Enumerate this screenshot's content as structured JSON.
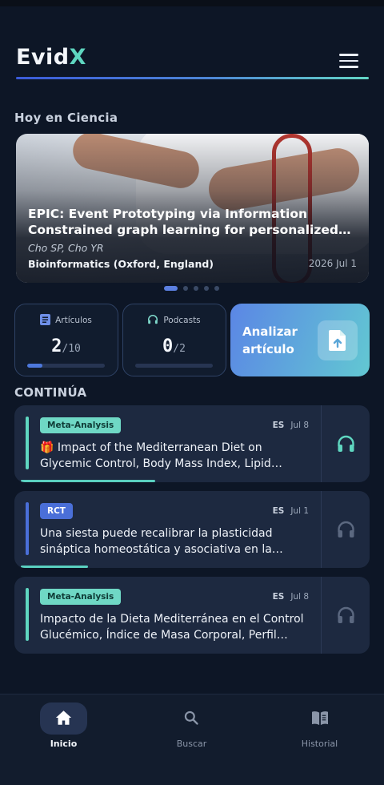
{
  "app": {
    "logo_main": "Evid",
    "logo_accent": "X",
    "menu_icon": "hamburger-menu-icon"
  },
  "today": {
    "section_title": "Hoy en Ciencia",
    "featured": {
      "title": "EPIC: Event Prototyping via Information Constrained graph learning for personalized care prediction",
      "authors": "Cho SP, Cho YR",
      "journal": "Bioinformatics (Oxford, England)",
      "date": "2026 Jul 1"
    },
    "carousel": {
      "count": 5,
      "active_index": 0
    }
  },
  "stats": {
    "articles": {
      "label": "Artículos",
      "icon": "document-icon",
      "value": "2",
      "total": "/10",
      "progress": 0.2
    },
    "podcasts": {
      "label": "Podcasts",
      "icon": "headphones-icon",
      "value": "0",
      "total": "/2",
      "progress": 0
    }
  },
  "analyze": {
    "label": "Analizar artículo",
    "icon": "file-upload-icon"
  },
  "continue": {
    "section_title": "CONTINÚA",
    "items": [
      {
        "badge": "Meta-Analysis",
        "badge_bg": "#6fd8c5",
        "badge_fg": "#0f3b36",
        "accent": "#5fd6c0",
        "lang": "ES",
        "date": "Jul 8",
        "emoji": "🎁",
        "title": "Impact of the Mediterranean Diet on Glycemic Control, Body Mass Index, Lipid Profile and Blood Pressure",
        "headphones_color": "#5fd6c0",
        "progress": 0.4
      },
      {
        "badge": "RCT",
        "badge_bg": "#4a6fd8",
        "badge_fg": "#ffffff",
        "accent": "#4a6fd8",
        "lang": "ES",
        "date": "Jul 1",
        "emoji": "",
        "title": "Una siesta puede recalibrar la plasticidad sináptica homeostática y asociativa en la corteza humana",
        "headphones_color": "#5b6880",
        "progress": 0.2
      },
      {
        "badge": "Meta-Analysis",
        "badge_bg": "#6fd8c5",
        "badge_fg": "#0f3b36",
        "accent": "#5fd6c0",
        "lang": "ES",
        "date": "Jul 8",
        "emoji": "",
        "title": "Impacto de la Dieta Mediterránea en el Control Glucémico, Índice de Masa Corporal, Perfil Lipídico y Presión Arterial",
        "headphones_color": "#5b6880",
        "progress": 0
      }
    ]
  },
  "nav": [
    {
      "label": "Inicio",
      "icon": "home-icon",
      "active": true
    },
    {
      "label": "Buscar",
      "icon": "search-icon",
      "active": false
    },
    {
      "label": "Historial",
      "icon": "book-icon",
      "active": false
    }
  ]
}
